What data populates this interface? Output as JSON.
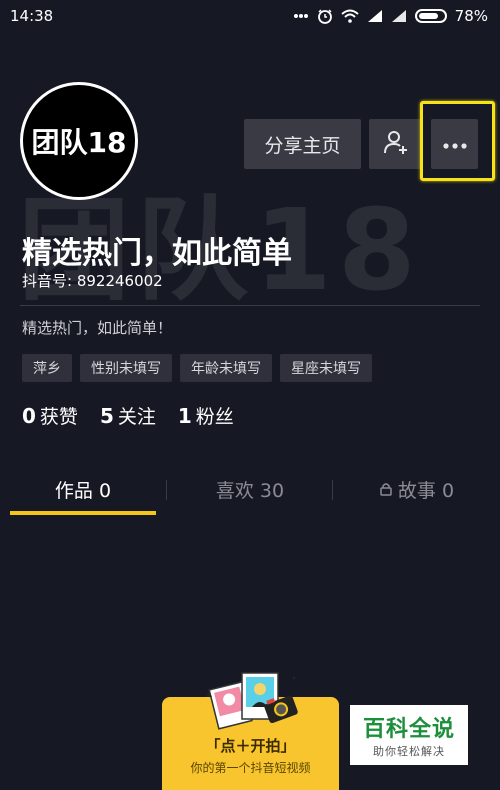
{
  "status_bar": {
    "time": "14:38",
    "battery": "78%",
    "icons": [
      "dots-icon",
      "alarm-icon",
      "wifi-icon",
      "signal-icon",
      "signal-icon",
      "battery-icon"
    ]
  },
  "profile": {
    "avatar_text": "团队18",
    "watermark": "团队18",
    "share_label": "分享主页",
    "nickname": "精选热门，如此简单",
    "douyin_id": "抖音号: 892246002",
    "bio": "精选热门，如此简单！",
    "tags": [
      "萍乡",
      "性别未填写",
      "年龄未填写",
      "星座未填写"
    ],
    "stats": {
      "likes": {
        "num": "0",
        "label": "获赞"
      },
      "following": {
        "num": "5",
        "label": "关注"
      },
      "fans": {
        "num": "1",
        "label": "粉丝"
      }
    },
    "highlight_color": "#f5e21a"
  },
  "tabs": {
    "works": "作品 0",
    "likes": "喜欢 30",
    "story": "故事 0",
    "active": "works",
    "accent": "#f5c518"
  },
  "cta": {
    "title": "「点＋开拍」",
    "subtitle": "你的第一个抖音短视频"
  },
  "logo": {
    "main": "百科全说",
    "sub": "助你轻松解决"
  }
}
